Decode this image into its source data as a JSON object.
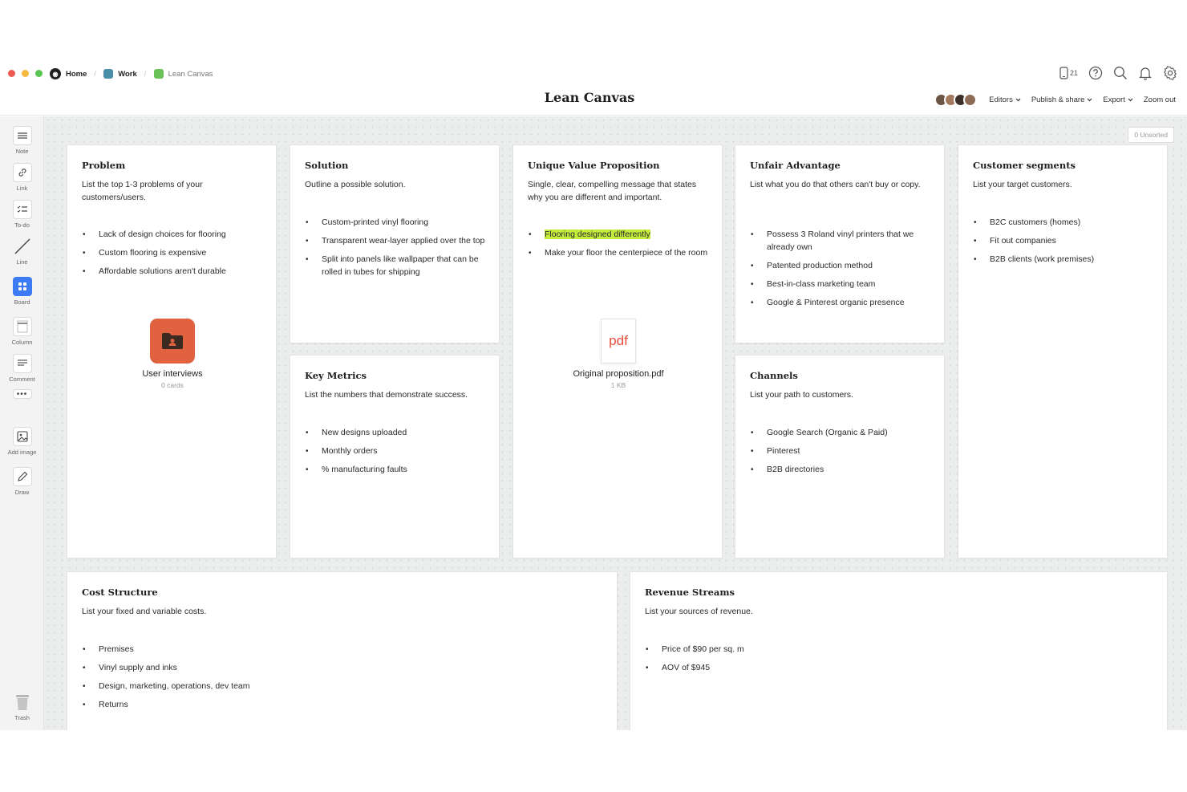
{
  "breadcrumb": {
    "home": "Home",
    "work": "Work",
    "current": "Lean Canvas"
  },
  "page_title": "Lean Canvas",
  "top_icons": {
    "device_count": "21"
  },
  "toolbar": {
    "editors": "Editors",
    "publish": "Publish & share",
    "export": "Export",
    "zoom": "Zoom out"
  },
  "sidebar": {
    "note": "Note",
    "link": "Link",
    "todo": "To-do",
    "line": "Line",
    "board": "Board",
    "column": "Column",
    "comment": "Comment",
    "add_image": "Add image",
    "draw": "Draw",
    "trash": "Trash"
  },
  "unsorted": "0 Unsorted",
  "cards": {
    "problem": {
      "title": "Problem",
      "desc": "List the top 1-3 problems of your customers/users.",
      "items": [
        "Lack of design choices for flooring",
        "Custom flooring is expensive",
        "Affordable solutions aren't durable"
      ],
      "attachment": {
        "title": "User interviews",
        "sub": "0 cards"
      }
    },
    "solution": {
      "title": "Solution",
      "desc": "Outline a possible solution.",
      "items": [
        "Custom-printed vinyl flooring",
        "Transparent wear-layer applied over the top",
        "Split into panels like wallpaper that can be rolled in tubes for shipping"
      ]
    },
    "key_metrics": {
      "title": "Key Metrics",
      "desc": "List the numbers that demonstrate success.",
      "items": [
        "New designs uploaded",
        "Monthly orders",
        "% manufacturing faults"
      ]
    },
    "uvp": {
      "title": "Unique Value Proposition",
      "desc": "Single, clear, compelling message that states why you are different and important.",
      "items": [
        "Flooring designed differently",
        "Make your floor the centerpiece of the room"
      ],
      "attachment": {
        "icon_text": "pdf",
        "title": "Original proposition.pdf",
        "sub": "1 KB"
      }
    },
    "unfair": {
      "title": "Unfair Advantage",
      "desc": "List what you do that others can't buy or copy.",
      "items": [
        "Possess 3 Roland vinyl printers that we already own",
        "Patented production method",
        "Best-in-class marketing team",
        "Google & Pinterest organic presence"
      ]
    },
    "channels": {
      "title": "Channels",
      "desc": "List your path to customers.",
      "items": [
        "Google Search (Organic & Paid)",
        "Pinterest",
        "B2B directories"
      ]
    },
    "segments": {
      "title": "Customer segments",
      "desc": "List your target customers.",
      "items": [
        "B2C customers (homes)",
        "Fit out companies",
        "B2B clients (work premises)"
      ]
    },
    "cost": {
      "title": "Cost Structure",
      "desc": "List your fixed and variable costs.",
      "items": [
        "Premises",
        "Vinyl supply and inks",
        "Design, marketing, operations, dev team",
        "Returns"
      ]
    },
    "revenue": {
      "title": "Revenue Streams",
      "desc": "List your sources of revenue.",
      "items": [
        "Price of $90 per sq. m",
        "AOV of $945"
      ]
    }
  }
}
